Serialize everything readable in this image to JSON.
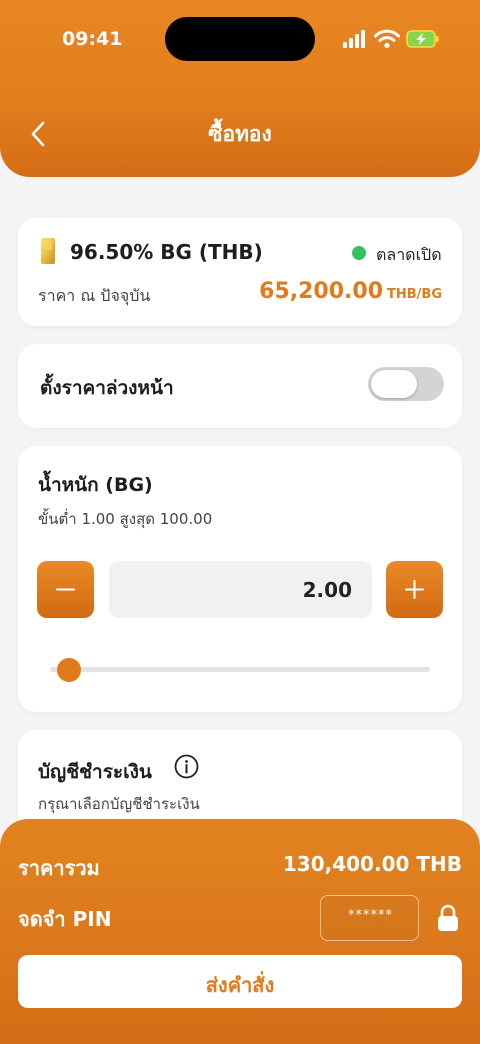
{
  "status_bar": {
    "time": "09:41"
  },
  "nav": {
    "title": "ซื้อทอง"
  },
  "product": {
    "name": "96.50% BG (THB)",
    "market_status": "ตลาดเปิด",
    "price_label": "ราคา ณ ปัจจุบัน",
    "price_value": "65,200.00",
    "price_unit": "THB/BG"
  },
  "advance_price": {
    "label": "ตั้งราคาล่วงหน้า",
    "enabled": false
  },
  "weight": {
    "title": "น้ำหนัก (BG)",
    "limits": "ขั้นต่ำ 1.00  สูงสุด 100.00",
    "quantity": "2.00",
    "slider_fraction": 0.0101
  },
  "account": {
    "title": "บัญชีชำระเงิน",
    "subtitle": "กรุณาเลือกบัญชีชำระเงิน"
  },
  "summary": {
    "total_label": "ราคารวม",
    "total_value": "130,400.00 THB",
    "pin_label": "จดจำ PIN",
    "pin_value": "******",
    "submit_label": "ส่งคำสั่ง"
  },
  "colors": {
    "brand_orange": "#e07b1a",
    "market_open_green": "#34c063",
    "toggle_off": "#d4d4d6"
  },
  "icons": {
    "back": "chevron-left-icon",
    "gold": "gold-bar-icon",
    "minus": "minus-icon",
    "plus": "plus-icon",
    "info": "info-icon",
    "lock": "lock-icon"
  }
}
